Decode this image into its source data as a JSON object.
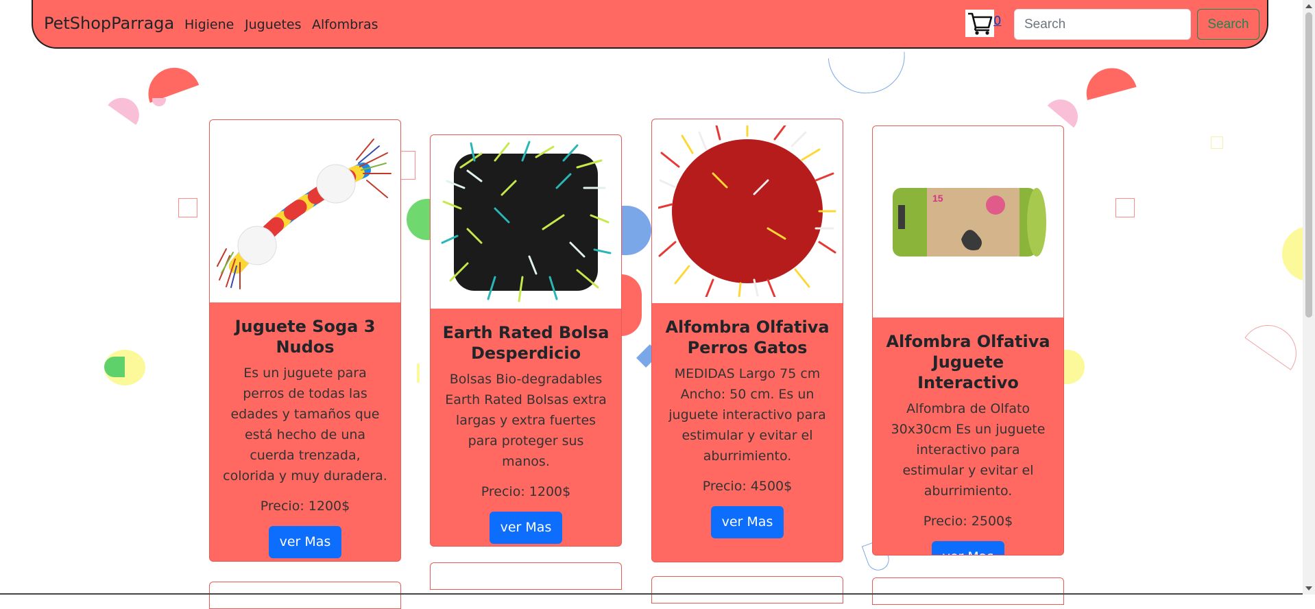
{
  "navbar": {
    "brand": "PetShopParraga",
    "links": [
      "Higiene",
      "Juguetes",
      "Alfombras"
    ],
    "cart_count": "0",
    "search_placeholder": "Search",
    "search_button": "Search"
  },
  "products": [
    {
      "title": "Juguete Soga 3 Nudos",
      "description": "Es un juguete para perros de todas las edades y tamaños que está hecho de una cuerda trenzada, colorida y muy duradera.",
      "price": "Precio: 1200$",
      "button": "ver Mas",
      "image": "rope-toy-image"
    },
    {
      "title": "Earth Rated Bolsa Desperdicio",
      "description": "Bolsas Bio-degradables Earth Rated Bolsas extra largas y extra fuertes para proteger sus manos.",
      "price": "Precio: 1200$",
      "button": "ver Mas",
      "image": "snuffle-mat-green-image"
    },
    {
      "title": "Alfombra Olfativa Perros Gatos",
      "description": "MEDIDAS Largo 75 cm Ancho: 50 cm. Es un juguete interactivo para estimular y evitar el aburrimiento.",
      "price": "Precio: 4500$",
      "button": "ver Mas",
      "image": "snuffle-mat-red-image"
    },
    {
      "title": "Alfombra Olfativa Juguete Interactivo",
      "description": "Alfombra de Olfato 30x30cm Es un juguete interactivo para estimular y evitar el aburrimiento.",
      "price": "Precio: 2500$",
      "button": "ver Mas",
      "image": "waste-bag-roll-image",
      "image_text": "15"
    }
  ],
  "colors": {
    "navbar_bg": "#ff6961",
    "card_bg": "#ff6961",
    "primary_button": "#0d6efd",
    "search_button": "#198754"
  }
}
